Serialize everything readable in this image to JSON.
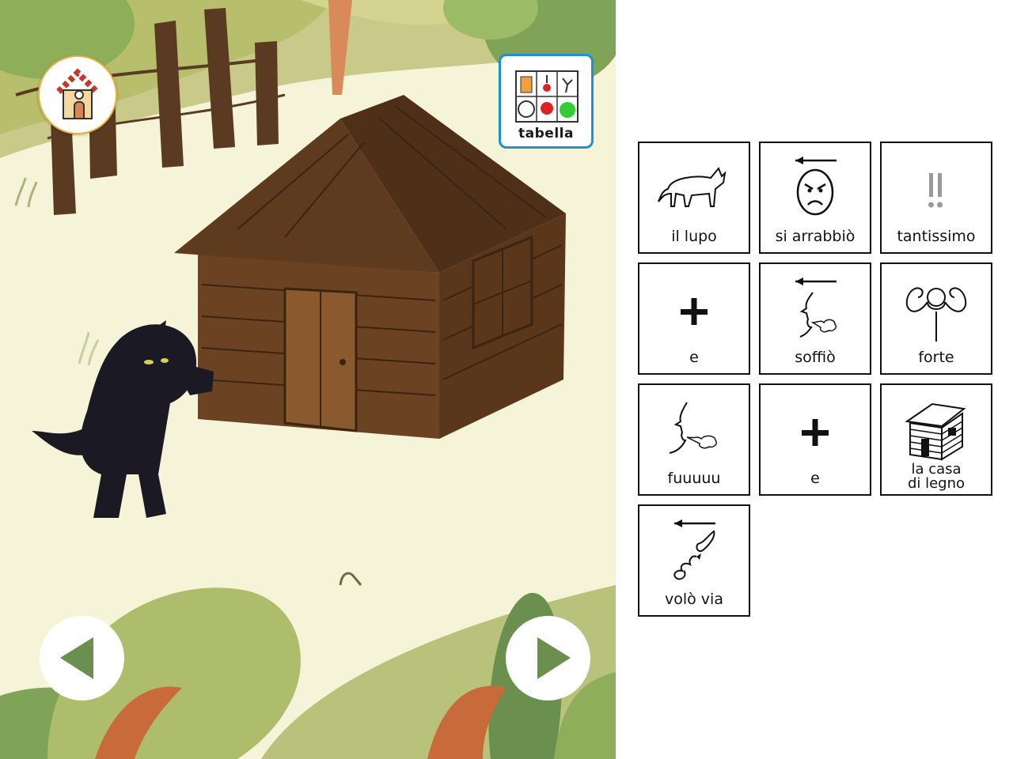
{
  "scene": {
    "home_icon": "house-icon",
    "prev_icon": "triangle-left-icon",
    "next_icon": "triangle-right-icon",
    "accent_color": "#6b8f4e"
  },
  "toolbar": {
    "tabella_label": "tabella",
    "tabella_icon": "symbol-board-icon",
    "tabella_border_color": "#1f8fd6"
  },
  "sentence": {
    "cards": [
      {
        "label": "il lupo",
        "icon": "wolf-icon"
      },
      {
        "label": "si arrabbiò",
        "icon": "angry-face-icon"
      },
      {
        "label": "tantissimo",
        "icon": "double-exclamation-icon"
      },
      {
        "label": "e",
        "icon": "plus-icon"
      },
      {
        "label": "soffiò",
        "icon": "blowing-past-icon"
      },
      {
        "label": "forte",
        "icon": "strong-arms-icon"
      },
      {
        "label": "fuuuuu",
        "icon": "blowing-icon"
      },
      {
        "label": "e",
        "icon": "plus-icon"
      },
      {
        "label_line1": "la casa",
        "label_line2": "di legno",
        "icon": "wooden-house-icon"
      },
      {
        "label": "volò via",
        "icon": "flying-away-icon"
      }
    ]
  }
}
